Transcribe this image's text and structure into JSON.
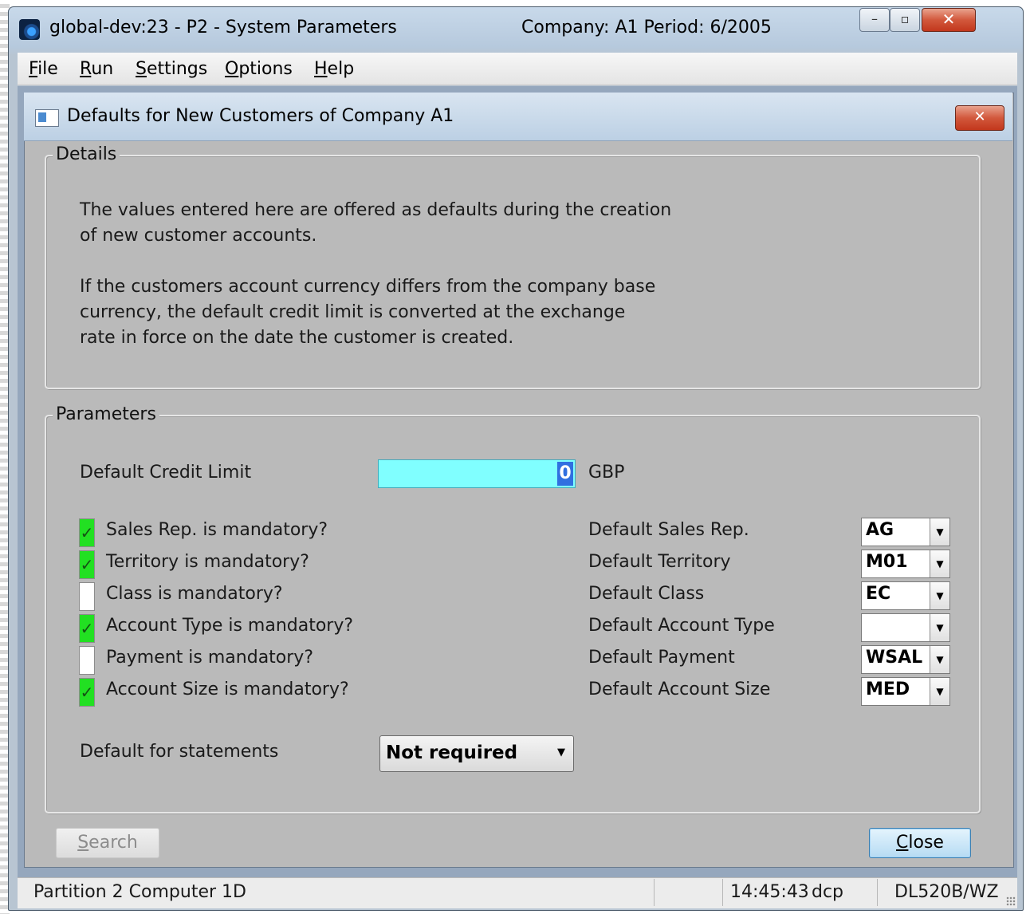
{
  "window": {
    "title": "global-dev:23 - P2 - System Parameters",
    "company_period": "Company: A1  Period:  6/2005",
    "minimize": "–",
    "maximize": "▫",
    "close": "✕"
  },
  "menu": [
    {
      "u": "F",
      "rest": "ile"
    },
    {
      "u": "R",
      "rest": "un"
    },
    {
      "u": "S",
      "rest": "ettings"
    },
    {
      "u": "O",
      "rest": "ptions"
    },
    {
      "u": "H",
      "rest": "elp"
    }
  ],
  "dialog": {
    "title": "Defaults for New Customers of Company A1",
    "close": "✕"
  },
  "details": {
    "legend": "Details",
    "para1": "The values entered here are offered as defaults during the creation\nof new customer accounts.",
    "para2": "If the customers account currency differs from the company base\ncurrency, the default credit limit is converted at the exchange\nrate in force on the date the customer is created."
  },
  "parameters": {
    "legend": "Parameters",
    "credit_label": "Default Credit Limit",
    "credit_value": "0",
    "currency": "GBP",
    "mandatory": [
      {
        "label": "Sales Rep. is mandatory?",
        "checked": true
      },
      {
        "label": "Territory is mandatory?",
        "checked": true
      },
      {
        "label": "Class is mandatory?",
        "checked": false
      },
      {
        "label": "Account Type is mandatory?",
        "checked": true
      },
      {
        "label": "Payment is mandatory?",
        "checked": false
      },
      {
        "label": "Account Size is mandatory?",
        "checked": true
      }
    ],
    "defaults": [
      {
        "label": "Default Sales Rep.",
        "value": "AG"
      },
      {
        "label": "Default Territory",
        "value": "M01"
      },
      {
        "label": "Default Class",
        "value": "EC"
      },
      {
        "label": "Default Account Type",
        "value": ""
      },
      {
        "label": "Default Payment",
        "value": "WSAL"
      },
      {
        "label": "Default Account Size",
        "value": "MED"
      }
    ],
    "statements_label": "Default for statements",
    "statements_value": "Not required"
  },
  "buttons": {
    "search": {
      "u": "S",
      "rest": "earch"
    },
    "close": {
      "u": "C",
      "rest": "lose"
    }
  },
  "status": {
    "left": "Partition 2 Computer 1D",
    "time": "14:45:43",
    "user": "dcp",
    "code": "DL520B/WZ"
  },
  "icons": {
    "app": "app-icon",
    "dialog": "dialog-icon",
    "check": "✓",
    "dropdown": "▼"
  },
  "colors": {
    "checked": "#22e022",
    "credit_field": "#80ffff",
    "dialog_bg": "#bababa"
  }
}
